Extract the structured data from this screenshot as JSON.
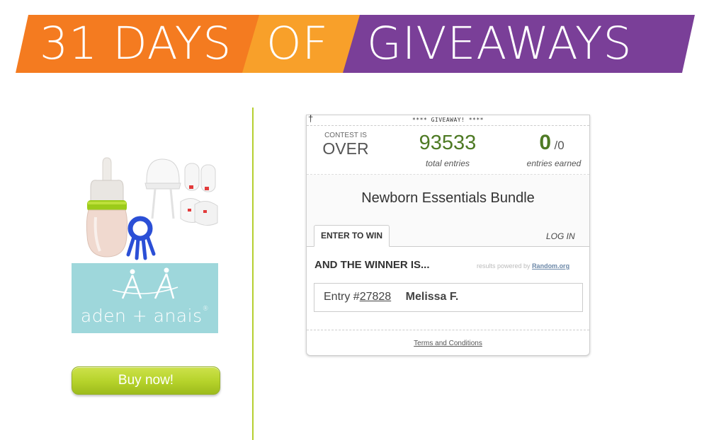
{
  "banner": {
    "part1": "31 DAYS",
    "part2": "OF",
    "part3": "GIVEAWAYS",
    "colors": {
      "orange": "#f47b20",
      "yellow": "#f8a02a",
      "purple": "#7a3f98"
    }
  },
  "left": {
    "product_image": "baby-bottle-teether-hat-mittens",
    "brand_logo_text": "aden + anais",
    "brand_reg": "®",
    "buy_button": "Buy now!",
    "accent_green": "#b6cf30"
  },
  "widget": {
    "header_label": "**** GIVEAWAY! ****",
    "header_icon": "cross-icon",
    "contest_label": "CONTEST IS",
    "contest_status": "OVER",
    "total_entries": "93533",
    "total_entries_label": "total entries",
    "entries_earned": "0",
    "entries_total": "/0",
    "entries_earned_label": "entries earned",
    "title": "Newborn Essentials Bundle",
    "tab_enter": "ENTER TO WIN",
    "tab_login": "LOG IN",
    "winner_heading": "AND THE WINNER IS...",
    "powered_prefix": "results powered by",
    "powered_link": "Random.org",
    "entry_prefix": "Entry #",
    "entry_number": "27828",
    "winner_name": "Melissa F.",
    "terms": "Terms and Conditions"
  }
}
